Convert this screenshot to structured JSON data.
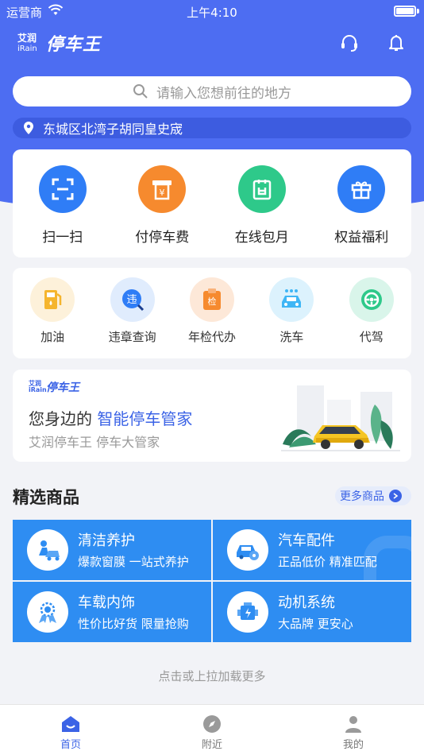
{
  "status_bar": {
    "carrier": "运营商",
    "time": "上午4:10"
  },
  "header": {
    "logo_small_cn": "艾润",
    "logo_small_en": "iRain",
    "logo_main": "停车王",
    "icons": [
      "headset-icon",
      "bell-icon"
    ]
  },
  "search": {
    "placeholder": "请输入您想前往的地方"
  },
  "location": {
    "text": "东城区北湾子胡同皇史宬"
  },
  "main_actions": [
    {
      "label": "扫一扫",
      "icon": "scan-icon",
      "color": "#2f7df6"
    },
    {
      "label": "付停车费",
      "icon": "pay-parking-icon",
      "color": "#f68a2e"
    },
    {
      "label": "在线包月",
      "icon": "calendar-icon",
      "color": "#2ec98a"
    },
    {
      "label": "权益福利",
      "icon": "gift-icon",
      "color": "#2f7df6"
    }
  ],
  "services": [
    {
      "label": "加油",
      "icon": "fuel-icon",
      "color": "#f5b52e"
    },
    {
      "label": "违章查询",
      "icon": "violation-icon",
      "glyph": "违",
      "color": "#2f7df6"
    },
    {
      "label": "年检代办",
      "icon": "inspection-icon",
      "glyph": "检",
      "color": "#f68a2e"
    },
    {
      "label": "洗车",
      "icon": "car-wash-icon",
      "color": "#3fb6f5"
    },
    {
      "label": "代驾",
      "icon": "steering-wheel-icon",
      "color": "#2ec98a"
    }
  ],
  "banner": {
    "logo_small_cn": "艾润",
    "logo_small_en": "iRain",
    "logo_main": "停车王",
    "title_prefix": "您身边的",
    "title_highlight": "智能停车管家",
    "subtitle": "艾润停车王 停车大管家"
  },
  "products_section": {
    "title": "精选商品",
    "more_label": "更多商品",
    "items": [
      {
        "title": "清洁养护",
        "subtitle": "爆款窗膜 一站式养护",
        "icon": "car-cleaning-icon"
      },
      {
        "title": "汽车配件",
        "subtitle": "正品低价 精准匹配",
        "icon": "car-parts-icon"
      },
      {
        "title": "车载内饰",
        "subtitle": "性价比好货 限量抢购",
        "icon": "interior-icon"
      },
      {
        "title": "动机系统",
        "subtitle": "大品牌 更安心",
        "icon": "engine-icon"
      }
    ]
  },
  "load_more": "点击或上拉加载更多",
  "tabs": [
    {
      "label": "首页",
      "icon": "home-icon",
      "active": true
    },
    {
      "label": "附近",
      "icon": "compass-icon",
      "active": false
    },
    {
      "label": "我的",
      "icon": "profile-icon",
      "active": false
    }
  ],
  "colors": {
    "primary": "#4d6df2",
    "accent": "#3b63e6",
    "product_tile": "#2e8df2"
  }
}
